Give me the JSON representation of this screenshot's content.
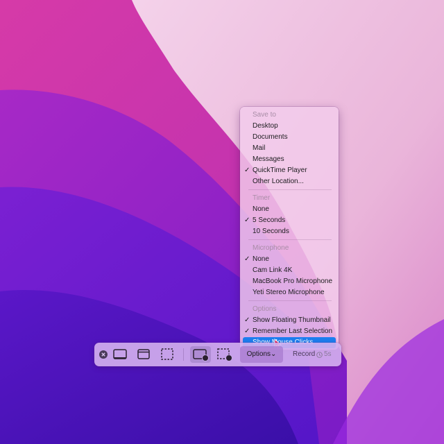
{
  "menu": {
    "sections": [
      {
        "header": "Save to",
        "items": [
          {
            "label": "Desktop",
            "checked": false
          },
          {
            "label": "Documents",
            "checked": false
          },
          {
            "label": "Mail",
            "checked": false
          },
          {
            "label": "Messages",
            "checked": false
          },
          {
            "label": "QuickTime Player",
            "checked": true
          },
          {
            "label": "Other Location...",
            "checked": false
          }
        ]
      },
      {
        "header": "Timer",
        "items": [
          {
            "label": "None",
            "checked": false
          },
          {
            "label": "5 Seconds",
            "checked": true
          },
          {
            "label": "10 Seconds",
            "checked": false
          }
        ]
      },
      {
        "header": "Microphone",
        "items": [
          {
            "label": "None",
            "checked": true
          },
          {
            "label": "Cam Link 4K",
            "checked": false
          },
          {
            "label": "MacBook Pro Microphone",
            "checked": false
          },
          {
            "label": "Yeti Stereo Microphone",
            "checked": false
          }
        ]
      },
      {
        "header": "Options",
        "items": [
          {
            "label": "Show Floating Thumbnail",
            "checked": true
          },
          {
            "label": "Remember Last Selection",
            "checked": true
          },
          {
            "label": "Show Mouse Clicks",
            "checked": false,
            "highlighted": true
          }
        ]
      }
    ],
    "check_glyph": "✓",
    "highlight_color": "#1c7ef0"
  },
  "toolbar": {
    "close_icon": "close-icon",
    "capture_buttons": [
      {
        "icon": "capture-entire-screen-icon",
        "active": false
      },
      {
        "icon": "capture-window-icon",
        "active": false
      },
      {
        "icon": "capture-selection-icon",
        "active": false
      },
      {
        "icon": "record-entire-screen-icon",
        "active": true
      },
      {
        "icon": "record-selection-icon",
        "active": false
      }
    ],
    "options_label": "Options",
    "options_chevron": "⌄",
    "record_label": "Record",
    "timer_label": "5s"
  }
}
